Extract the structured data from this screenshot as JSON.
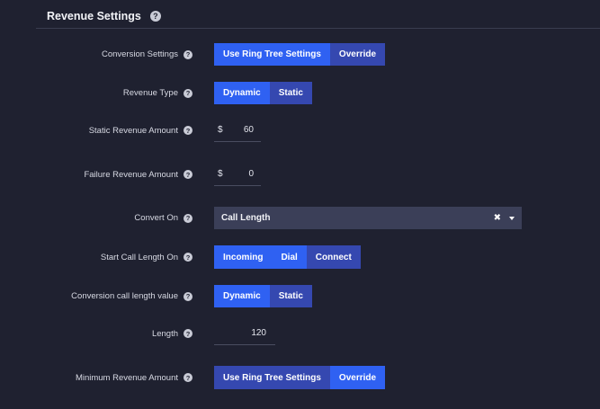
{
  "section": {
    "title": "Revenue Settings"
  },
  "fields": {
    "conversion_settings": {
      "label": "Conversion Settings",
      "options": [
        "Use Ring Tree Settings",
        "Override"
      ],
      "selected": "Use Ring Tree Settings"
    },
    "revenue_type": {
      "label": "Revenue Type",
      "options": [
        "Dynamic",
        "Static"
      ],
      "selected": "Dynamic"
    },
    "static_revenue_amount": {
      "label": "Static Revenue Amount",
      "currency": "$",
      "value": "60"
    },
    "failure_revenue_amount": {
      "label": "Failure Revenue Amount",
      "currency": "$",
      "value": "0"
    },
    "convert_on": {
      "label": "Convert On",
      "value": "Call Length",
      "clear_glyph": "✖"
    },
    "start_call_length_on": {
      "label": "Start Call Length On",
      "options": [
        "Incoming",
        "Dial",
        "Connect"
      ],
      "selected": "Incoming"
    },
    "conversion_call_length_value": {
      "label": "Conversion call length value",
      "options": [
        "Dynamic",
        "Static"
      ],
      "selected": "Dynamic"
    },
    "length": {
      "label": "Length",
      "value": "120"
    },
    "minimum_revenue_amount": {
      "label": "Minimum Revenue Amount",
      "options": [
        "Use Ring Tree Settings",
        "Override"
      ],
      "selected": "Override"
    }
  },
  "help_glyph": "?",
  "colors": {
    "background": "#1f2130",
    "active_button": "#2f61f2",
    "inactive_button": "#3548b0",
    "select_background": "#3b3f58"
  }
}
